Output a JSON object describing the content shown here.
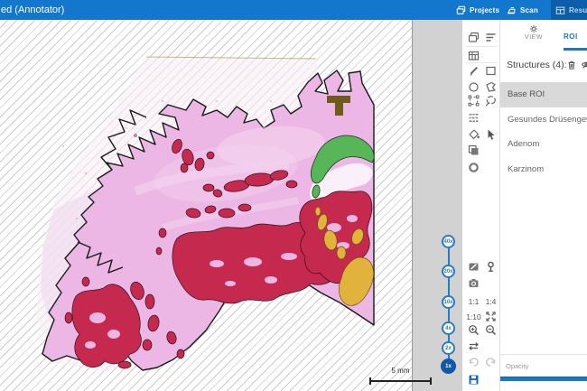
{
  "titlebar": {
    "title": "ed (Annotator)",
    "color": "#1377cd",
    "nav": [
      {
        "label": "Projects",
        "icon": "projects-icon"
      },
      {
        "label": "Scan",
        "icon": "scan-icon"
      },
      {
        "label": "Results",
        "icon": "results-icon",
        "active": true
      }
    ]
  },
  "viewer": {
    "scale_bar": {
      "label": "5 mm"
    },
    "zoom_slider": {
      "levels": [
        "40x",
        "20x",
        "10x",
        "4x",
        "2x",
        "1x"
      ],
      "active": "1x"
    }
  },
  "toolstrip": {
    "tool_icons": [
      "images-icon",
      "sort-icon",
      "table-icon",
      "pen-icon",
      "rectangle-icon",
      "circle-icon",
      "polygon-icon",
      "transform-icon",
      "lasso-icon",
      "pixel-select-icon",
      "fill-icon",
      "cursor-icon",
      "copy-icon",
      "ellipse-icon"
    ],
    "view_icons": [
      "annotation-icon",
      "pin-icon",
      "camera-icon",
      "fullscreen-icon",
      "zoom-in-icon",
      "zoom-out-icon",
      "swap-icon",
      "undo-icon",
      "redo-icon",
      "save-icon"
    ],
    "ratios": {
      "one_to_one": "1:1",
      "one_to_four": "1:4",
      "one_to_ten": "1:10"
    }
  },
  "panel": {
    "tabs": [
      {
        "label": "VIEW",
        "icon": "gear-icon"
      },
      {
        "label": "ROI",
        "active": true
      }
    ],
    "structures_header": "Structures (4):",
    "header_icons": [
      "trash-icon",
      "hide-all-icon"
    ],
    "structures": [
      {
        "name": "Base ROI",
        "selected": true,
        "color": "#1a1a1a"
      },
      {
        "name": "Gesundes Drüsengewebe",
        "color": "#57b657"
      },
      {
        "name": "Adenom",
        "color": "#e2b33c"
      },
      {
        "name": "Karzinom",
        "color": "#c5294e"
      }
    ],
    "opacity": {
      "label": "Opacity",
      "value_percent": 100
    }
  }
}
